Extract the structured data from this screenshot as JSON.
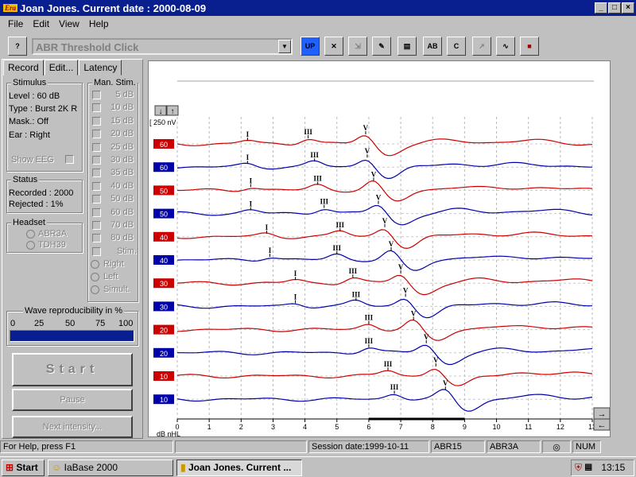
{
  "window": {
    "title": "Joan Jones. Current date : 2000-08-09",
    "logo": "Era"
  },
  "menu": [
    "File",
    "Edit",
    "View",
    "Help"
  ],
  "toolbar": {
    "test_combo": "ABR Threshold Click",
    "buttons": [
      "help-icon",
      "setup-icon",
      "compare-icon",
      "zoom-icon",
      "edit-icon",
      "print-icon",
      "mark-ab-icon",
      "mark-c-icon",
      "cursor-icon",
      "waveform-icon",
      "save-icon"
    ]
  },
  "tabs": [
    "Record",
    "Edit...",
    "Latency"
  ],
  "stimulus": {
    "label": "Stimulus",
    "level": "Level : 60 dB",
    "type": "Type : Burst  2K R",
    "mask": "Mask.: Off",
    "ear": "Ear :    Right",
    "show_eeg": "Show EEG"
  },
  "status": {
    "label": "Status",
    "recorded": "Recorded : 2000",
    "rejected": "Rejected :   1%"
  },
  "headset": {
    "label": "Headset",
    "options": [
      "ABR3A",
      "TDH39"
    ]
  },
  "man_stim": {
    "label": "Man. Stim.",
    "levels": [
      "5 dB",
      "10 dB",
      "15 dB",
      "20 dB",
      "25 dB",
      "30 dB",
      "35 dB",
      "40 dB",
      "50 dB",
      "60 dB",
      "70 dB",
      "80 dB",
      "Stim."
    ],
    "ear_options": [
      "Right",
      "Left",
      "Simult."
    ]
  },
  "reproducibility": {
    "label": "Wave reproducibility in %",
    "ticks": [
      "0",
      "25",
      "50",
      "75",
      "100"
    ],
    "value": 100
  },
  "buttons": {
    "start": "Start",
    "pause": "Pause",
    "next": "Next intensity..."
  },
  "plot": {
    "scale_label": "[ 250 nV",
    "x_unit": "mS",
    "y_unit": "dB nHL",
    "x_ticks": [
      "0",
      "1",
      "2",
      "3",
      "4",
      "5",
      "6",
      "7",
      "8",
      "9",
      "10",
      "11",
      "12",
      "13"
    ],
    "traces": [
      {
        "level": "60",
        "color": "#cc0000",
        "peaks": [
          {
            "label": "I",
            "x": 2.2
          },
          {
            "label": "III",
            "x": 4.1
          },
          {
            "label": "V",
            "x": 5.9
          }
        ]
      },
      {
        "level": "60",
        "color": "#0000aa",
        "peaks": [
          {
            "label": "I",
            "x": 2.2
          },
          {
            "label": "III",
            "x": 4.3
          },
          {
            "label": "V",
            "x": 5.95
          }
        ]
      },
      {
        "level": "50",
        "color": "#cc0000",
        "peaks": [
          {
            "label": "I",
            "x": 2.3
          },
          {
            "label": "III",
            "x": 4.4
          },
          {
            "label": "V",
            "x": 6.15
          }
        ]
      },
      {
        "level": "50",
        "color": "#0000aa",
        "peaks": [
          {
            "label": "I",
            "x": 2.3
          },
          {
            "label": "III",
            "x": 4.6
          },
          {
            "label": "V",
            "x": 6.3
          }
        ]
      },
      {
        "level": "40",
        "color": "#cc0000",
        "peaks": [
          {
            "label": "I",
            "x": 2.8
          },
          {
            "label": "III",
            "x": 5.1
          },
          {
            "label": "V",
            "x": 6.5
          }
        ]
      },
      {
        "level": "40",
        "color": "#0000aa",
        "peaks": [
          {
            "label": "I",
            "x": 2.9
          },
          {
            "label": "III",
            "x": 5.0
          },
          {
            "label": "V",
            "x": 6.7
          }
        ]
      },
      {
        "level": "30",
        "color": "#cc0000",
        "peaks": [
          {
            "label": "I",
            "x": 3.7
          },
          {
            "label": "III",
            "x": 5.5
          },
          {
            "label": "V",
            "x": 7.0
          }
        ]
      },
      {
        "level": "30",
        "color": "#0000aa",
        "peaks": [
          {
            "label": "I",
            "x": 3.7
          },
          {
            "label": "III",
            "x": 5.6
          },
          {
            "label": "V",
            "x": 7.15
          }
        ]
      },
      {
        "level": "20",
        "color": "#cc0000",
        "peaks": [
          {
            "label": "III",
            "x": 6.0
          },
          {
            "label": "V",
            "x": 7.4
          }
        ]
      },
      {
        "level": "20",
        "color": "#0000aa",
        "peaks": [
          {
            "label": "III",
            "x": 6.0
          },
          {
            "label": "V",
            "x": 7.8
          }
        ]
      },
      {
        "level": "10",
        "color": "#cc0000",
        "peaks": [
          {
            "label": "III",
            "x": 6.6
          },
          {
            "label": "V",
            "x": 8.1
          }
        ]
      },
      {
        "level": "10",
        "color": "#0000aa",
        "peaks": [
          {
            "label": "III",
            "x": 6.8
          },
          {
            "label": "V",
            "x": 8.4
          }
        ]
      }
    ]
  },
  "statusbar": [
    "For Help, press F1",
    "Session date:1999-10-11",
    "ABR15",
    "ABR3A",
    "NUM"
  ],
  "taskbar": {
    "start": "Start",
    "items": [
      "IaBase 2000",
      "Joan Jones. Current ..."
    ],
    "clock": "13:15"
  }
}
